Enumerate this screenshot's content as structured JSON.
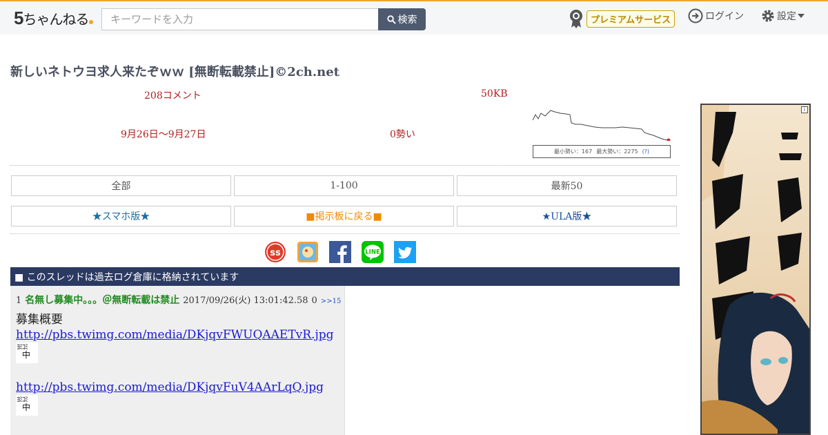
{
  "header": {
    "logo_text": "ちゃんねる",
    "logo_number": "5",
    "search_placeholder": "キーワードを入力",
    "search_button": "検索",
    "premium_label": "プレミアムサービス",
    "login_label": "ログイン",
    "settings_label": "設定"
  },
  "thread": {
    "title": "新しいネトウヨ求人来たぞｗｗ [無断転載禁止]©2ch.net",
    "comments": "208コメント",
    "size": "50KB",
    "dates": "9月26日〜9月27日",
    "speed": "0勢い",
    "graph_min": "最小勢い：167",
    "graph_max": "最大勢い：2275",
    "graph_help": "(?)"
  },
  "nav": {
    "all": "全部",
    "range": "1-100",
    "latest": "最新50",
    "smartphone": "★スマホ版★",
    "board_back": "■掲示板に戻る■",
    "ula": "★ULA版★"
  },
  "archive_notice": "■ このスレッドは過去ログ倉庫に格納されています",
  "post": {
    "number": "1",
    "name": "名無し募集中。。。＠無断転載は禁止",
    "date": "2017/09/26(火) 13:01:42.58",
    "id": "0",
    "reply": ">>15",
    "heading": "募集概要",
    "link1": "http://pbs.twimg.com/media/DKjqvFWUQAAETvR.jpg",
    "link2": "http://pbs.twimg.com/media/DKjqvFuV4AArLqQ.jpg",
    "thumb_top": "ﾖﾐｺﾐ",
    "thumb_bottom": "中"
  },
  "colors": {
    "accent": "#f0a428",
    "banner": "#2b3a62",
    "stat_red": "#b01e1e",
    "name_green": "#228b22"
  },
  "icons": [
    "search-icon",
    "medal-icon",
    "login-icon",
    "gear-icon",
    "caret-down-icon",
    "susu-icon",
    "orange-app-icon",
    "facebook-icon",
    "line-icon",
    "twitter-icon"
  ]
}
